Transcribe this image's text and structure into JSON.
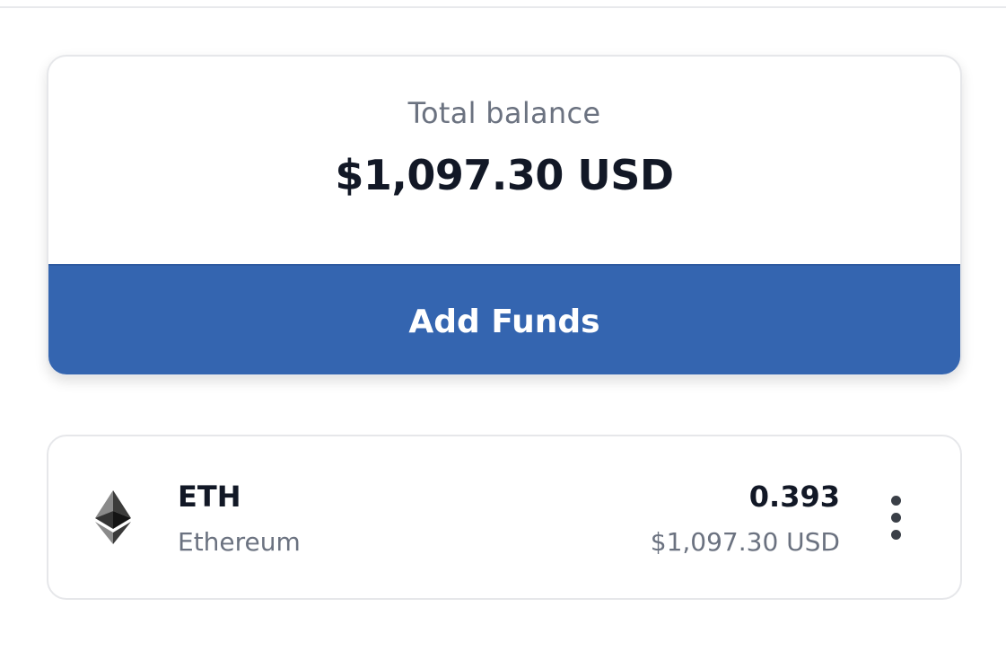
{
  "balance": {
    "label": "Total balance",
    "amount": "$1,097.30 USD",
    "action_label": "Add Funds"
  },
  "assets": [
    {
      "symbol": "ETH",
      "name": "Ethereum",
      "amount": "0.393",
      "value": "$1,097.30 USD",
      "icon": "ethereum-icon"
    }
  ],
  "colors": {
    "accent": "#3465b0",
    "text_primary": "#121826",
    "text_secondary": "#6b7280",
    "border": "#e6e7ea"
  }
}
